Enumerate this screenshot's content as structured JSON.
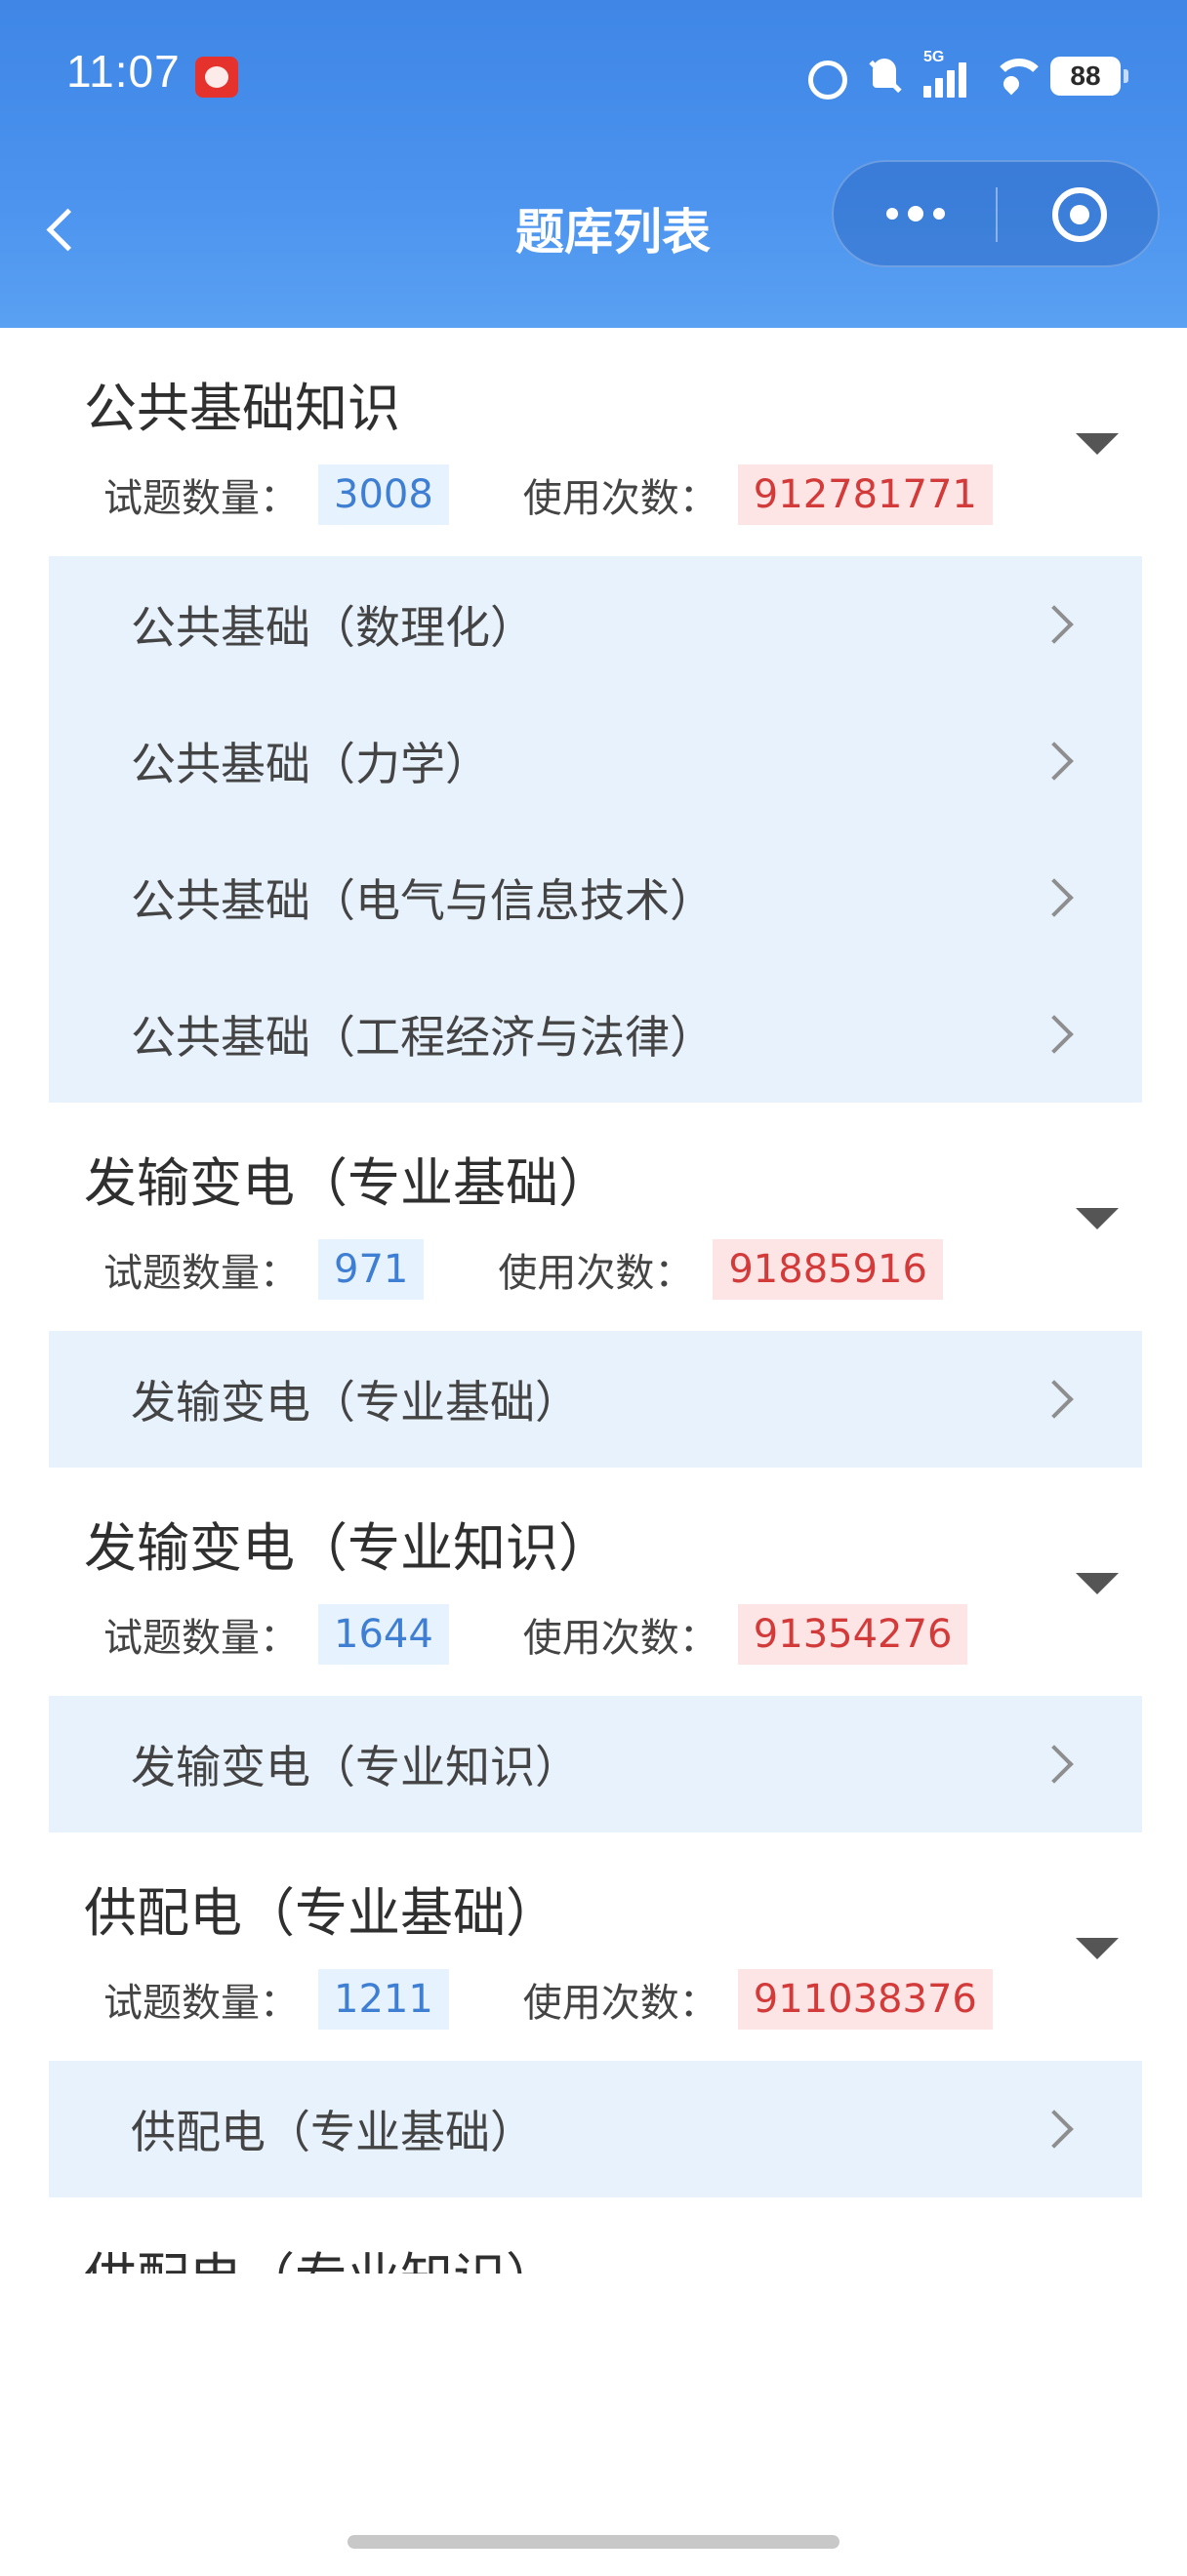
{
  "status_bar": {
    "time": "11:07",
    "network": "5G",
    "battery": "88"
  },
  "nav": {
    "title": "题库列表"
  },
  "groups": [
    {
      "title": "公共基础知识",
      "count_label": "试题数量：",
      "count": "3008",
      "usage_label": "使用次数：",
      "usage": "912781771",
      "items": [
        {
          "label": "公共基础（数理化）"
        },
        {
          "label": "公共基础（力学）"
        },
        {
          "label": "公共基础（电气与信息技术）"
        },
        {
          "label": "公共基础（工程经济与法律）"
        }
      ]
    },
    {
      "title": "发输变电（专业基础）",
      "count_label": "试题数量：",
      "count": "971",
      "usage_label": "使用次数：",
      "usage": "91885916",
      "items": [
        {
          "label": "发输变电（专业基础）"
        }
      ]
    },
    {
      "title": "发输变电（专业知识）",
      "count_label": "试题数量：",
      "count": "1644",
      "usage_label": "使用次数：",
      "usage": "91354276",
      "items": [
        {
          "label": "发输变电（专业知识）"
        }
      ]
    },
    {
      "title": "供配电（专业基础）",
      "count_label": "试题数量：",
      "count": "1211",
      "usage_label": "使用次数：",
      "usage": "911038376",
      "items": [
        {
          "label": "供配电（专业基础）"
        }
      ]
    },
    {
      "title": "供配电（专业知识）"
    }
  ],
  "colors": {
    "header": "#4b93ee",
    "sub_bg": "#e8f2fd",
    "count_bg": "#e6f2fd",
    "count_text": "#3e7fd3",
    "usage_bg": "#fde5e5",
    "usage_text": "#d33a3a"
  },
  "icons": [
    "back-icon",
    "more-icon",
    "target-icon",
    "caret-icon",
    "chevron-icon",
    "alarm-icon",
    "bell-muted-icon",
    "signal-icon",
    "wifi-icon",
    "battery-icon"
  ]
}
